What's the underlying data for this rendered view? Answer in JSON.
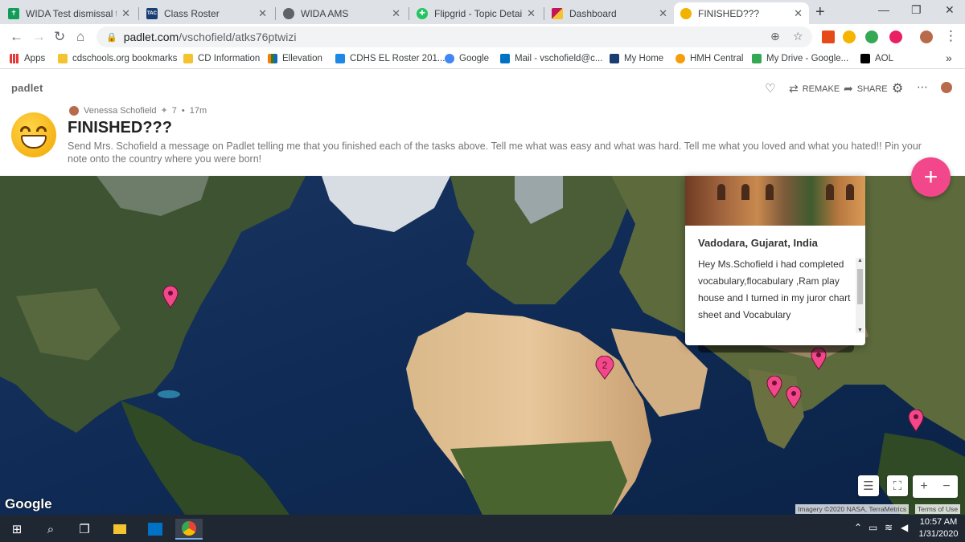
{
  "browser": {
    "tabs": [
      {
        "title": "WIDA Test dismissal tim",
        "color": "#0f9d58",
        "glyph": "✝",
        "active": false
      },
      {
        "title": "Class Roster",
        "color": "#1a3e73",
        "glyph": "TAC",
        "active": false
      },
      {
        "title": "WIDA AMS",
        "color": "#5f6368",
        "glyph": "",
        "active": false
      },
      {
        "title": "Flipgrid - Topic Details",
        "color": "#22c55e",
        "glyph": "✚",
        "active": false
      },
      {
        "title": "Dashboard",
        "color": "#c2185b",
        "glyph": "",
        "active": false
      },
      {
        "title": "FINISHED???",
        "color": "#f2b200",
        "glyph": "",
        "active": true
      }
    ],
    "url_domain": "padlet.com",
    "url_path": "/vschofield/atks76ptwizi",
    "bookmarks": [
      {
        "label": "Apps",
        "color": "#e53935"
      },
      {
        "label": "cdschools.org bookmarks",
        "color": "#f4c430"
      },
      {
        "label": "CD Information",
        "color": "#f4c430"
      },
      {
        "label": "Ellevation",
        "color": "#2e7d32"
      },
      {
        "label": "CDHS EL Roster 201...",
        "color": "#1e88e5"
      },
      {
        "label": "Google",
        "color": "#4285f4"
      },
      {
        "label": "Mail - vschofield@c...",
        "color": "#0072c6"
      },
      {
        "label": "My Home",
        "color": "#1a3e73"
      },
      {
        "label": "HMH Central",
        "color": "#f59e0b"
      },
      {
        "label": "My Drive - Google...",
        "color": "#34a853"
      },
      {
        "label": "AOL",
        "color": "#000000"
      }
    ],
    "bookmarks_more": "»"
  },
  "padlet": {
    "logo": "padlet",
    "actions": {
      "remake": "REMAKE",
      "share": "SHARE"
    },
    "author": "Venessa Schofield",
    "meta_sep": "•",
    "likes": "7",
    "age": "17m",
    "title": "FINISHED???",
    "description": "Send Mrs. Schofield a message on Padlet telling me that you finished each of the tasks above. Tell me what was easy and what was hard. Tell me what you loved and what you hated!! Pin your note onto the country where you were born!",
    "fab": "+",
    "cluster_count": "2",
    "accent": "#f2478a"
  },
  "card": {
    "place": "Vadodara, Gujarat, India",
    "text": "Hey Ms.Schofield i had completed vocabulary,flocabulary ,Ram play house and I turned in my juror chart sheet and Vocabulary"
  },
  "map": {
    "google": "Google",
    "credits": "Imagery ©2020 NASA, TerraMetrics",
    "terms": "Terms of Use",
    "zoom_in": "+",
    "zoom_out": "−"
  },
  "taskbar": {
    "time": "10:57 AM",
    "date": "1/31/2020"
  }
}
